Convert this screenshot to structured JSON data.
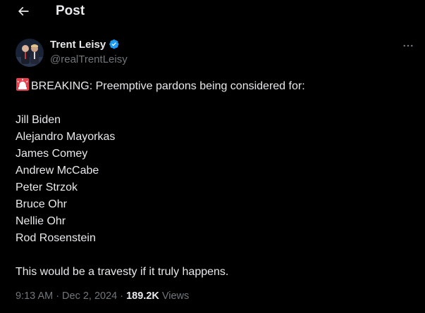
{
  "header": {
    "title": "Post",
    "back_icon": "arrow-left-icon"
  },
  "author": {
    "display_name": "Trent Leisy",
    "handle": "@realTrentLeisy",
    "verified_icon": "verified-badge-icon",
    "verified_color": "#1d9bf0",
    "avatar_icon": "avatar-photo"
  },
  "more_icon": "more-options-icon",
  "post": {
    "emoji_icon": "police-siren-icon",
    "headline": "BREAKING: Preemptive pardons being considered for:",
    "names": [
      "Jill Biden",
      "Alejandro Mayorkas",
      "James Comey",
      "Andrew McCabe",
      "Peter Strzok",
      "Bruce Ohr",
      "Nellie Ohr",
      "Rod Rosenstein"
    ],
    "closing": "This would be a travesty if it truly happens."
  },
  "meta": {
    "time": "9:13 AM",
    "separator": "·",
    "date": "Dec 2, 2024",
    "views_count": "189.2K",
    "views_label": "Views"
  },
  "colors": {
    "background": "#000000",
    "text": "#e7e9ea",
    "secondary_text": "#71767b",
    "siren_red": "#e8414c"
  }
}
